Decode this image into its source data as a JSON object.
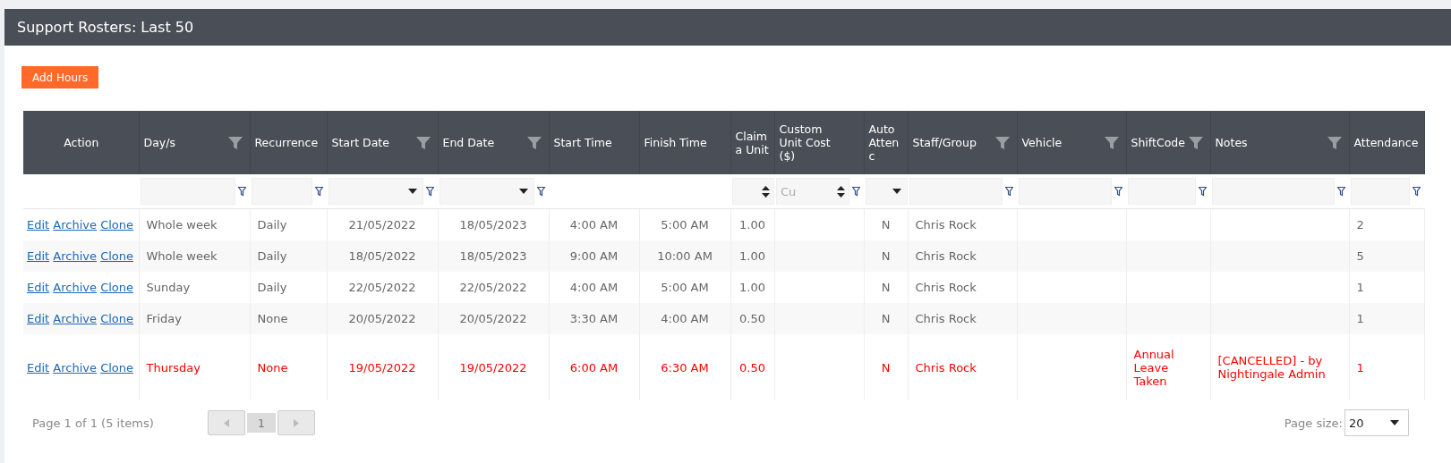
{
  "title": "Support Rosters: Last 50",
  "add_button": "Add Hours",
  "columns": [
    {
      "label": "Action",
      "filter_icon": false,
      "filter": {
        "kind": "none",
        "button": false
      }
    },
    {
      "label": "Day/s",
      "filter_icon": true,
      "filter": {
        "kind": "text",
        "button": true
      }
    },
    {
      "label": "Recurrence",
      "filter_icon": false,
      "filter": {
        "kind": "text",
        "button": true
      }
    },
    {
      "label": "Start Date",
      "filter_icon": true,
      "filter": {
        "kind": "select",
        "button": true
      }
    },
    {
      "label": "End Date",
      "filter_icon": true,
      "filter": {
        "kind": "select",
        "button": true
      }
    },
    {
      "label": "Start Time",
      "filter_icon": false,
      "filter": {
        "kind": "none",
        "button": false
      }
    },
    {
      "label": "Finish Time",
      "filter_icon": false,
      "filter": {
        "kind": "none",
        "button": false
      }
    },
    {
      "label": "Claima Unit",
      "filter_icon": false,
      "filter": {
        "kind": "spin",
        "button": false
      }
    },
    {
      "label": "Custom Unit Cost ($)",
      "filter_icon": false,
      "filter": {
        "kind": "spin",
        "placeholder": "Cu",
        "button": true
      }
    },
    {
      "label": "Auto Attenc",
      "filter_icon": false,
      "filter": {
        "kind": "select",
        "button": false
      }
    },
    {
      "label": "Staff/Group",
      "filter_icon": true,
      "filter": {
        "kind": "text",
        "button": true
      }
    },
    {
      "label": "Vehicle",
      "filter_icon": true,
      "filter": {
        "kind": "text",
        "button": true
      }
    },
    {
      "label": "ShiftCode",
      "filter_icon": true,
      "filter": {
        "kind": "text",
        "button": true
      }
    },
    {
      "label": "Notes",
      "filter_icon": true,
      "filter": {
        "kind": "text",
        "button": true
      }
    },
    {
      "label": "Attendance",
      "filter_icon": false,
      "filter": {
        "kind": "text",
        "button": true
      }
    }
  ],
  "rows": [
    {
      "cancelled": false,
      "actions": [
        "Edit",
        "Archive",
        "Clone"
      ],
      "cells": [
        "Whole week",
        "Daily",
        "21/05/2022",
        "18/05/2023",
        "4:00 AM",
        "5:00 AM",
        "1.00",
        null,
        "N",
        "Chris Rock",
        null,
        null,
        null,
        "2"
      ]
    },
    {
      "cancelled": false,
      "actions": [
        "Edit",
        "Archive",
        "Clone"
      ],
      "cells": [
        "Whole week",
        "Daily",
        "18/05/2022",
        "18/05/2023",
        "9:00 AM",
        "10:00 AM",
        "1.00",
        null,
        "N",
        "Chris Rock",
        null,
        null,
        null,
        "5"
      ]
    },
    {
      "cancelled": false,
      "actions": [
        "Edit",
        "Archive",
        "Clone"
      ],
      "cells": [
        "Sunday",
        "Daily",
        "22/05/2022",
        "22/05/2022",
        "4:00 AM",
        "5:00 AM",
        "1.00",
        null,
        "N",
        "Chris Rock",
        null,
        null,
        null,
        "1"
      ]
    },
    {
      "cancelled": false,
      "actions": [
        "Edit",
        "Archive",
        "Clone"
      ],
      "cells": [
        "Friday",
        "None",
        "20/05/2022",
        "20/05/2022",
        "3:30 AM",
        "4:00 AM",
        "0.50",
        null,
        "N",
        "Chris Rock",
        null,
        null,
        null,
        "1"
      ]
    },
    {
      "cancelled": true,
      "actions": [
        "Edit",
        "Archive",
        "Clone"
      ],
      "cells": [
        "Thursday",
        "None",
        "19/05/2022",
        "19/05/2022",
        "6:00 AM",
        "6:30 AM",
        "0.50",
        null,
        "N",
        "Chris Rock",
        null,
        "Annual Leave Taken",
        "[CANCELLED] - by Nightingale Admin",
        "1"
      ]
    }
  ],
  "pager": {
    "summary": "Page 1 of 1 (5 items)",
    "prev_disabled": true,
    "next_disabled": true,
    "pages": [
      {
        "label": "1",
        "selected": true
      }
    ],
    "page_size_label": "Page size:",
    "page_size": "20"
  }
}
